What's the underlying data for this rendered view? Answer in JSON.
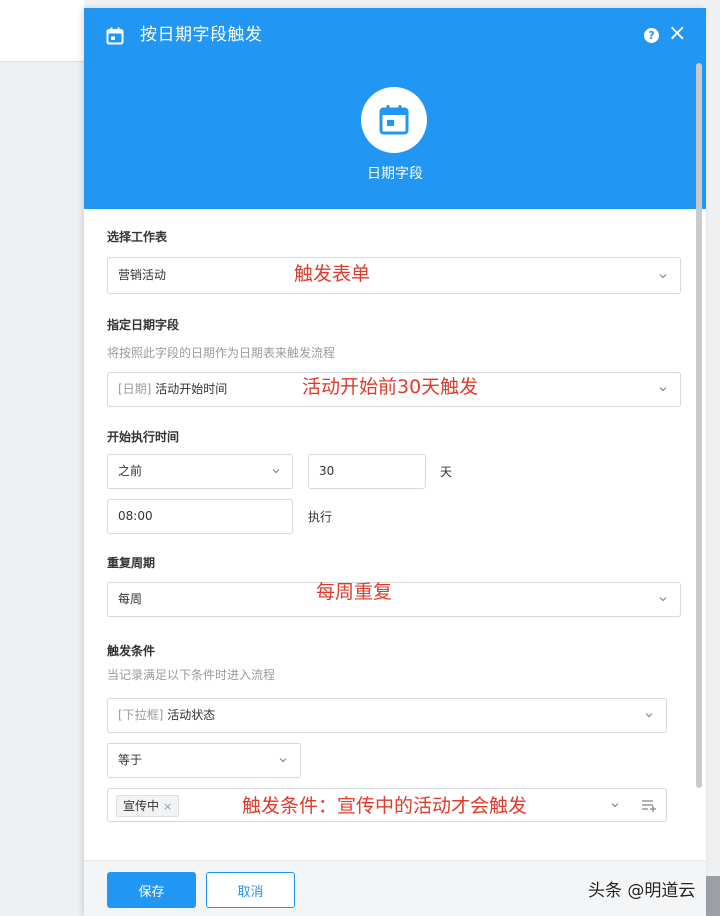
{
  "header": {
    "title": "按日期字段触发",
    "help_icon": "?",
    "close_icon": "×",
    "center_label": "日期字段",
    "background_color": "#2196f3"
  },
  "form": {
    "worksheet": {
      "label": "选择工作表",
      "value": "营销活动",
      "annotation": "触发表单"
    },
    "date_field": {
      "label": "指定日期字段",
      "hint": "将按照此字段的日期作为日期表来触发流程",
      "value_prefix": "[日期]",
      "value": "活动开始时间",
      "annotation": "活动开始前30天触发"
    },
    "start_time": {
      "label": "开始执行时间",
      "direction": "之前",
      "offset_value": "30",
      "offset_unit": "天",
      "time_value": "08:00",
      "time_suffix": "执行"
    },
    "repeat": {
      "label": "重复周期",
      "value": "每周",
      "annotation": "每周重复"
    },
    "conditions": {
      "label": "触发条件",
      "hint": "当记录满足以下条件时进入流程",
      "field_prefix": "[下拉框]",
      "field_value": "活动状态",
      "operator": "等于",
      "tag": "宣传中",
      "tag_remove": "×",
      "annotation": "触发条件：宣传中的活动才会触发"
    }
  },
  "footer": {
    "save_label": "保存",
    "cancel_label": "取消"
  },
  "watermark": "头条 @明道云"
}
